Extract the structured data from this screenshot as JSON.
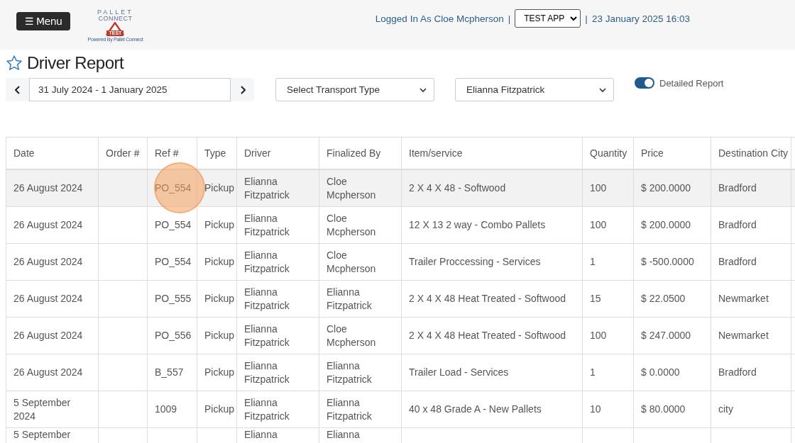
{
  "header": {
    "menu_button": "☰ Menu",
    "logo": {
      "top": "PALLET",
      "middle": "CONNECT",
      "badge": "TEST",
      "tagline": "Powered By Pallet Connect"
    },
    "logged_in": "Logged In As Cloe Mcpherson",
    "separator_1": "|",
    "app_select": "TEST APP",
    "separator_2": "|",
    "datetime": "23 January 2025 16:03"
  },
  "page": {
    "title": "Driver Report",
    "favorite": false
  },
  "filters": {
    "date_range": "31 July 2024 - 1 January 2025",
    "transport_type": "Select Transport Type",
    "driver": "Elianna Fitzpatrick",
    "detailed_report": {
      "label": "Detailed Report",
      "on": true
    }
  },
  "table": {
    "columns": [
      "Date",
      "Order #",
      "Ref #",
      "Type",
      "Driver",
      "Finalized By",
      "Item/service",
      "Quantity",
      "Price",
      "Destination City"
    ],
    "rows": [
      {
        "selected": true,
        "click_marker": true,
        "cells": [
          "26 August 2024",
          "",
          "PO_554",
          "Pickup",
          "Elianna Fitzpatrick",
          "Cloe Mcpherson",
          "2 X 4 X 48 - Softwood",
          "100",
          "$ 200.0000",
          "Bradford"
        ]
      },
      {
        "selected": false,
        "cells": [
          "26 August 2024",
          "",
          "PO_554",
          "Pickup",
          "Elianna Fitzpatrick",
          "Cloe Mcpherson",
          "12 X 13 2 way - Combo Pallets",
          "100",
          "$ 200.0000",
          "Bradford"
        ]
      },
      {
        "selected": false,
        "cells": [
          "26 August 2024",
          "",
          "PO_554",
          "Pickup",
          "Elianna Fitzpatrick",
          "Cloe Mcpherson",
          "Trailer Proccessing - Services",
          "1",
          "$ -500.0000",
          "Bradford"
        ]
      },
      {
        "selected": false,
        "cells": [
          "26 August 2024",
          "",
          "PO_555",
          "Pickup",
          "Elianna Fitzpatrick",
          "Elianna Fitzpatrick",
          "2 X 4 X 48 Heat Treated - Softwood",
          "15",
          "$ 22.0500",
          "Newmarket"
        ]
      },
      {
        "selected": false,
        "cells": [
          "26 August 2024",
          "",
          "PO_556",
          "Pickup",
          "Elianna Fitzpatrick",
          "Cloe Mcpherson",
          "2 X 4 X 48 Heat Treated - Softwood",
          "100",
          "$ 247.0000",
          "Newmarket"
        ]
      },
      {
        "selected": false,
        "cells": [
          "26 August 2024",
          "",
          "B_557",
          "Pickup",
          "Elianna Fitzpatrick",
          "Elianna Fitzpatrick",
          "Trailer Load - Services",
          "1",
          "$ 0.0000",
          "Bradford"
        ]
      },
      {
        "selected": false,
        "cells": [
          "5 September 2024",
          "",
          "1009",
          "Pickup",
          "Elianna Fitzpatrick",
          "Elianna Fitzpatrick",
          "40 x 48 Grade A - New Pallets",
          "10",
          "$ 80.0000",
          "city"
        ]
      },
      {
        "selected": false,
        "cells": [
          "5 September",
          "",
          "",
          "",
          "Elianna",
          "Elianna",
          "",
          "",
          "",
          ""
        ]
      }
    ]
  }
}
